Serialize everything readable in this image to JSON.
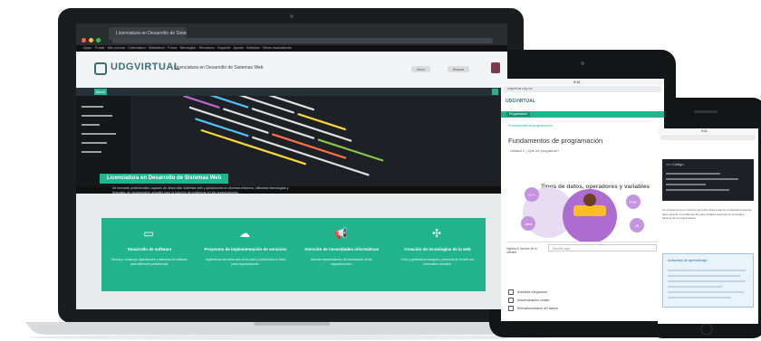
{
  "laptop": {
    "browser": {
      "tab_title": "Licenciatura en Desarrollo de Sistemas Web",
      "bookmarks": "Apps  ·  Portal  ·  Mis cursos  ·  Calendario  ·  Biblioteca  ·  Foros  ·  Mensajes  ·  Recursos  ·  Soporte  ·  Ayuda  ·  Noticias  ·  Otros marcadores"
    },
    "site": {
      "logo": "UDGVIRTUAL",
      "subtitle": "Licenciatura en Desarrollo de Sistemas Web",
      "header_buttons": [
        "Inicio",
        "Buscar"
      ],
      "nav_button": "Menú"
    },
    "hero": {
      "title": "Licenciatura en Desarrollo de Sistemas Web",
      "description": "Se formarán profesionales capaces de desarrollar sistemas web y aplicaciones en diversos entornos, utilizando tecnologías y lenguajes de programación actuales para la solución de problemas en las organizaciones."
    },
    "features": [
      {
        "icon": "monitor-icon",
        "title": "Desarrollo de software",
        "desc": "Diseña y construye aplicaciones y sistemas de software para diferentes plataformas."
      },
      {
        "icon": "cloud-upload-icon",
        "title": "Proyectos de implementación de servicios",
        "desc": "Implementa servicios web en la nube y soluciones en línea para organizaciones."
      },
      {
        "icon": "megaphone-icon",
        "title": "Atención de necesidades informáticas",
        "desc": "Atiende requerimientos de información de las organizaciones."
      },
      {
        "icon": "network-icon",
        "title": "Creación de tecnologías de la web",
        "desc": "Crea y gestiona tecnologías y servicios de la web con estándares actuales."
      }
    ]
  },
  "tablet": {
    "status_time": "9:41",
    "url": "udgvirtual.udg.mx",
    "logo": "UDGVIRTUAL",
    "green_tab": "Programación",
    "breadcrumb": "Fundamentos de programación",
    "title": "Fundamentos de programación",
    "subtitle": "Unidad 1 ¿Qué es programar?",
    "diagram_title": "Tipos de datos, operadores y variables",
    "diagram_nodes": [
      "C++",
      "Java",
      "PHP",
      "JS",
      "SQL"
    ],
    "form_label": "Ingresa el nombre de la variable",
    "form_placeholder": "Escribe aquí",
    "checklist": [
      "Actividad integradora",
      "Autoevaluación unidad",
      "Retroalimentación del asesor"
    ]
  },
  "phone": {
    "status_time": "9:41",
    "code_title": "</> Código",
    "text": "Un programa es un conjunto de instrucciones que la computadora ejecuta para resolver un problema. En esta unidad conocerás los conceptos básicos de la programación.",
    "box_title": "Actividad de aprendizaje"
  },
  "colors": {
    "accent": "#22b38f",
    "brand": "#3c6e78",
    "dark": "#1d2125"
  }
}
